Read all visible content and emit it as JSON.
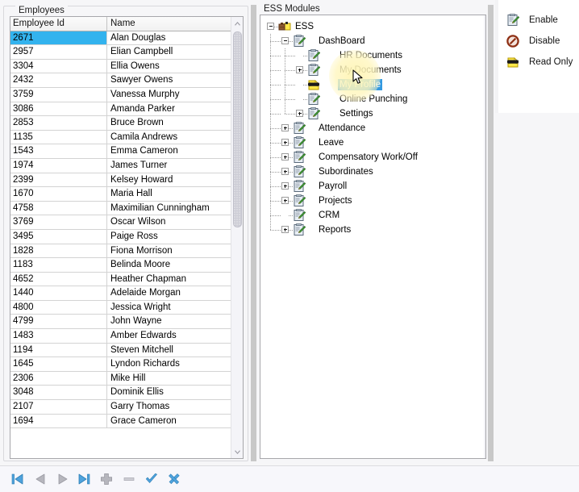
{
  "window": {
    "background": "#f6f6f8"
  },
  "employees_panel": {
    "caption": "Employees",
    "columns": [
      "Employee Id",
      "Name"
    ],
    "selected_row_index": 0,
    "selection_color": "#33b3ee",
    "rows": [
      {
        "id": "2671",
        "name": "Alan Douglas"
      },
      {
        "id": "2957",
        "name": "Elian Campbell"
      },
      {
        "id": "3304",
        "name": "Ellia Owens"
      },
      {
        "id": "2432",
        "name": "Sawyer Owens"
      },
      {
        "id": "3759",
        "name": "Vanessa Murphy"
      },
      {
        "id": "3086",
        "name": "Amanda Parker"
      },
      {
        "id": "2853",
        "name": "Bruce Brown"
      },
      {
        "id": "1135",
        "name": "Camila Andrews"
      },
      {
        "id": "1543",
        "name": "Emma Cameron"
      },
      {
        "id": "1974",
        "name": "James Turner"
      },
      {
        "id": "2399",
        "name": "Kelsey Howard"
      },
      {
        "id": "1670",
        "name": "Maria Hall"
      },
      {
        "id": "4758",
        "name": "Maximilian Cunningham"
      },
      {
        "id": "3769",
        "name": "Oscar Wilson"
      },
      {
        "id": "3495",
        "name": "Paige Ross"
      },
      {
        "id": "1828",
        "name": "Fiona Morrison"
      },
      {
        "id": "1183",
        "name": "Belinda Moore"
      },
      {
        "id": "4652",
        "name": "Heather Chapman"
      },
      {
        "id": "1440",
        "name": "Adelaide Morgan"
      },
      {
        "id": "4800",
        "name": "Jessica Wright"
      },
      {
        "id": "4799",
        "name": "John Wayne"
      },
      {
        "id": "1483",
        "name": "Amber Edwards"
      },
      {
        "id": "1194",
        "name": "Steven Mitchell"
      },
      {
        "id": "1645",
        "name": "Lyndon Richards"
      },
      {
        "id": "2306",
        "name": "Mike Hill"
      },
      {
        "id": "3048",
        "name": "Dominik Ellis"
      },
      {
        "id": "2107",
        "name": "Garry Thomas"
      },
      {
        "id": "1694",
        "name": "Grace Cameron"
      }
    ],
    "scrollbar": {
      "up_icon": "scroll-up-arrow-icon",
      "down_icon": "scroll-down-arrow-icon"
    }
  },
  "ess_panel": {
    "caption": "ESS Modules",
    "tree": [
      {
        "label": "ESS",
        "level": 0,
        "expander": "minus",
        "icon": "module-root-icon"
      },
      {
        "label": "DashBoard",
        "level": 1,
        "expander": "minus",
        "icon": "page-edit-icon"
      },
      {
        "label": "HR Documents",
        "level": 2,
        "expander": "none",
        "icon": "page-edit-icon"
      },
      {
        "label": "My Documents",
        "level": 2,
        "expander": "plus",
        "icon": "page-edit-icon"
      },
      {
        "label": "My Profile",
        "level": 2,
        "expander": "none",
        "icon": "read-only-sunglasses-icon",
        "selected": true
      },
      {
        "label": "Online Punching",
        "level": 2,
        "expander": "none",
        "icon": "page-edit-icon"
      },
      {
        "label": "Settings",
        "level": 2,
        "expander": "plus",
        "icon": "page-edit-icon"
      },
      {
        "label": "Attendance",
        "level": 1,
        "expander": "plus",
        "icon": "page-edit-icon"
      },
      {
        "label": "Leave",
        "level": 1,
        "expander": "plus",
        "icon": "page-edit-icon"
      },
      {
        "label": "Compensatory Work/Off",
        "level": 1,
        "expander": "plus",
        "icon": "page-edit-icon"
      },
      {
        "label": "Subordinates",
        "level": 1,
        "expander": "plus",
        "icon": "page-edit-icon"
      },
      {
        "label": "Payroll",
        "level": 1,
        "expander": "plus",
        "icon": "page-edit-icon"
      },
      {
        "label": "Projects",
        "level": 1,
        "expander": "plus",
        "icon": "page-edit-icon"
      },
      {
        "label": "CRM",
        "level": 1,
        "expander": "none",
        "icon": "page-edit-icon"
      },
      {
        "label": "Reports",
        "level": 1,
        "expander": "plus",
        "icon": "page-edit-icon"
      }
    ],
    "selected_node": "My Profile",
    "selection_color": "#3399e0"
  },
  "context_menu": {
    "items": [
      {
        "label": "Enable",
        "icon": "enable-page-edit-icon"
      },
      {
        "label": "Disable",
        "icon": "disable-forbidden-icon"
      },
      {
        "label": "Read Only",
        "icon": "read-only-sunglasses-icon"
      }
    ]
  },
  "navigator": {
    "buttons": [
      {
        "name": "first-record-button",
        "icon": "nav-first-icon",
        "state": "enabled"
      },
      {
        "name": "prev-record-button",
        "icon": "nav-prev-icon",
        "state": "disabled"
      },
      {
        "name": "next-record-button",
        "icon": "nav-next-icon",
        "state": "disabled"
      },
      {
        "name": "last-record-button",
        "icon": "nav-last-icon",
        "state": "enabled"
      },
      {
        "name": "add-record-button",
        "icon": "plus-icon",
        "state": "disabled"
      },
      {
        "name": "delete-record-button",
        "icon": "minus-icon",
        "state": "disabled"
      },
      {
        "name": "confirm-button",
        "icon": "check-icon",
        "state": "enabled"
      },
      {
        "name": "cancel-button",
        "icon": "cancel-x-icon",
        "state": "enabled"
      }
    ],
    "accent_color": "#4fa3dd"
  }
}
